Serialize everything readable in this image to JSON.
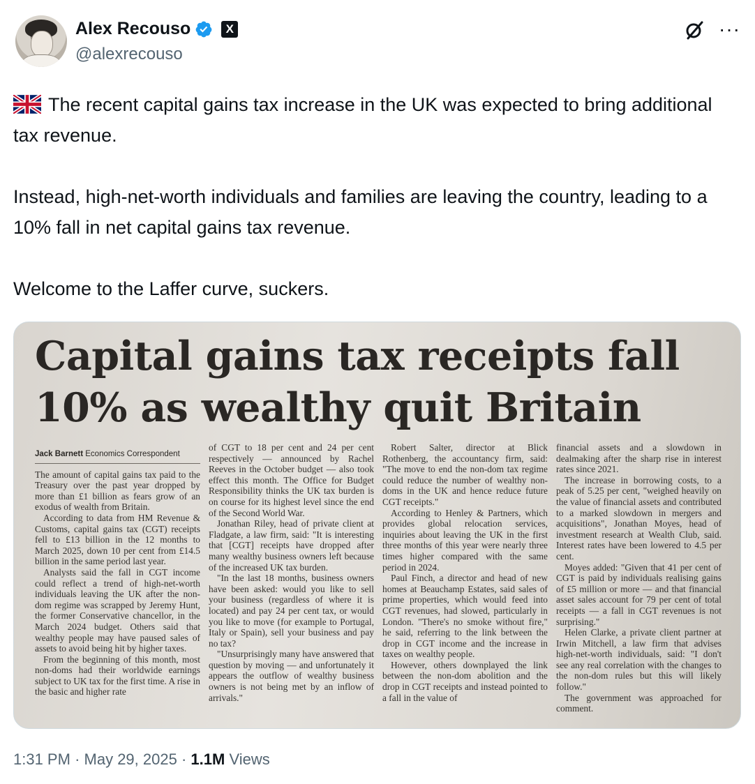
{
  "author": {
    "name": "Alex Recouso",
    "handle": "@alexrecouso",
    "verified": true,
    "affiliate_badge": "X"
  },
  "tweet": {
    "flag": "uk-flag",
    "paragraphs": [
      "The recent capital gains tax increase in the UK was expected to bring additional tax revenue.",
      "Instead, high-net-worth individuals and families are leaving the country, leading to a 10% fall in net capital gains tax revenue.",
      "Welcome to the Laffer curve, suckers."
    ]
  },
  "article": {
    "headline_line1": "Capital gains tax receipts fall",
    "headline_line2": "10% as wealthy quit Britain",
    "byline_name": "Jack Barnett",
    "byline_role": "Economics Correspondent",
    "col1": [
      "The amount of capital gains tax paid to the Treasury over the past year dropped by more than £1 billion as fears grow of an exodus of wealth from Britain.",
      "According to data from HM Revenue & Customs, capital gains tax (CGT) receipts fell to £13 billion in the 12 months to March 2025, down 10 per cent from £14.5 billion in the same period last year.",
      "Analysts said the fall in CGT income could reflect a trend of high-net-worth individuals leaving the UK after the non-dom regime was scrapped by Jeremy Hunt, the former Conservative chancellor, in the March 2024 budget. Others said that wealthy people may have paused sales of assets to avoid being hit by higher taxes.",
      "From the beginning of this month, most non-doms had their worldwide earnings subject to UK tax for the first time. A rise in the basic and higher rate"
    ],
    "col2": [
      "of CGT to 18 per cent and 24 per cent respectively — announced by Rachel Reeves in the October budget — also took effect this month. The Office for Budget Responsibility thinks the UK tax burden is on course for its highest level since the end of the Second World War.",
      "Jonathan Riley, head of private client at Fladgate, a law firm, said: \"It is interesting that [CGT] receipts have dropped after many wealthy business owners left because of the increased UK tax burden.",
      "\"In the last 18 months, business owners have been asked: would you like to sell your business (regardless of where it is located) and pay 24 per cent tax, or would you like to move (for example to Portugal, Italy or Spain), sell your business and pay no tax?",
      "\"Unsurprisingly many have answered that question by moving — and unfortunately it appears the outflow of wealthy business owners is not being met by an inflow of arrivals.\""
    ],
    "col3": [
      "Robert Salter, director at Blick Rothenberg, the accountancy firm, said: \"The move to end the non-dom tax regime could reduce the number of wealthy non-doms in the UK and hence reduce future CGT receipts.\"",
      "According to Henley & Partners, which provides global relocation services, inquiries about leaving the UK in the first three months of this year were nearly three times higher compared with the same period in 2024.",
      "Paul Finch, a director and head of new homes at Beauchamp Estates, said sales of prime properties, which would feed into CGT revenues, had slowed, particularly in London. \"There's no smoke without fire,\" he said, referring to the link between the drop in CGT income and the increase in taxes on wealthy people.",
      "However, others downplayed the link between the non-dom abolition and the drop in CGT receipts and instead pointed to a fall in the value of"
    ],
    "col4": [
      "financial assets and a slowdown in dealmaking after the sharp rise in interest rates since 2021.",
      "The increase in borrowing costs, to a peak of 5.25 per cent, \"weighed heavily on the value of financial assets and contributed to a marked slowdown in mergers and acquisitions\", Jonathan Moyes, head of investment research at Wealth Club, said. Interest rates have been lowered to 4.5 per cent.",
      "Moyes added: \"Given that 41 per cent of CGT is paid by individuals realising gains of £5 million or more — and that financial asset sales account for 79 per cent of total receipts — a fall in CGT revenues is not surprising.\"",
      "Helen Clarke, a private client partner at Irwin Mitchell, a law firm that advises high-net-worth individuals, said: \"I don't see any real correlation with the changes to the non-dom rules but this will likely follow.\"",
      "The government was approached for comment."
    ]
  },
  "footer": {
    "time": "1:31 PM",
    "sep1": "·",
    "date": "May 29, 2025",
    "sep2": "·",
    "views_count": "1.1M",
    "views_label": "Views"
  },
  "icons": {
    "grok": "grok-icon",
    "more": "more-icon",
    "verified": "verified-badge-icon"
  },
  "colors": {
    "text": "#0f1419",
    "secondary": "#536471",
    "verified_blue": "#1d9bf0"
  }
}
